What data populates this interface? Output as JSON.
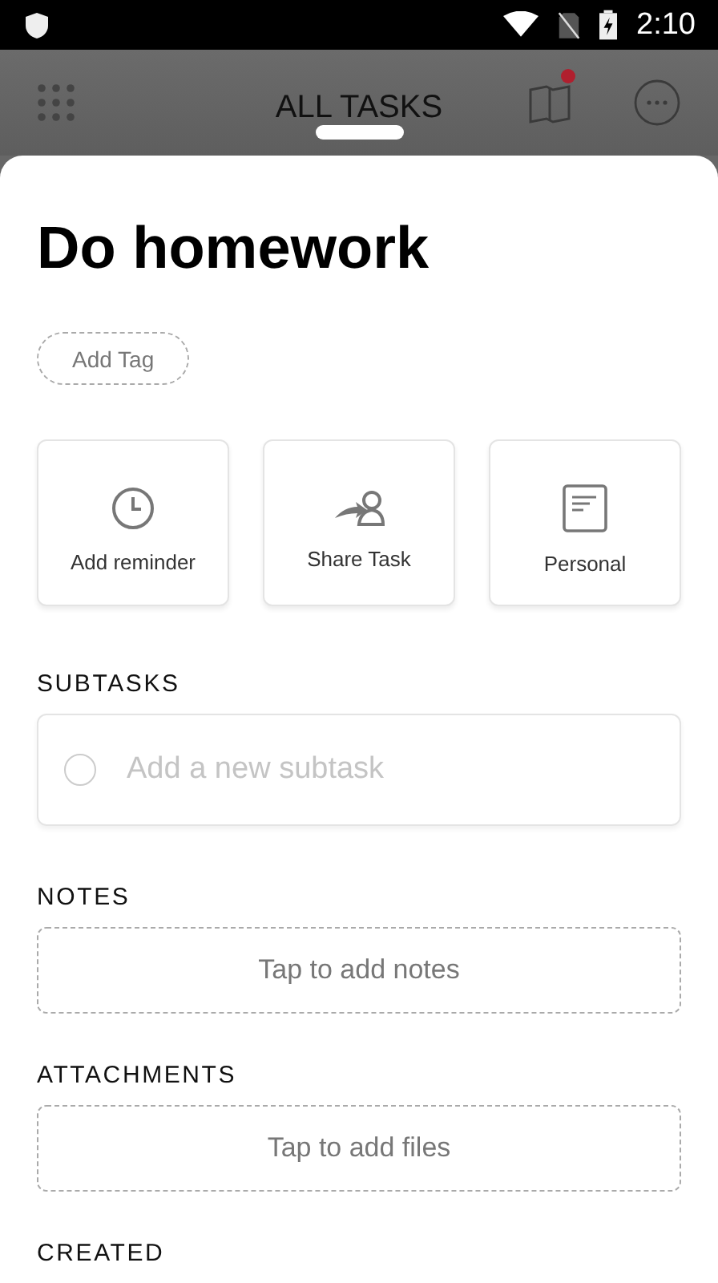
{
  "status_bar": {
    "time": "2:10"
  },
  "header": {
    "title": "ALL TASKS",
    "notes_button": {
      "has_notification": true
    }
  },
  "task": {
    "title": "Do homework",
    "add_tag": "Add Tag"
  },
  "actions": [
    {
      "kind": "clock",
      "label": "Add reminder"
    },
    {
      "kind": "share",
      "label": "Share Task"
    },
    {
      "kind": "list",
      "label": "Personal"
    }
  ],
  "subtasks": {
    "heading": "SUBTASKS",
    "placeholder": "Add a new subtask"
  },
  "notes": {
    "heading": "NOTES",
    "prompt": "Tap to add notes"
  },
  "attachments": {
    "heading": "ATTACHMENTS",
    "prompt": "Tap to add files"
  },
  "created": {
    "heading": "CREATED"
  }
}
